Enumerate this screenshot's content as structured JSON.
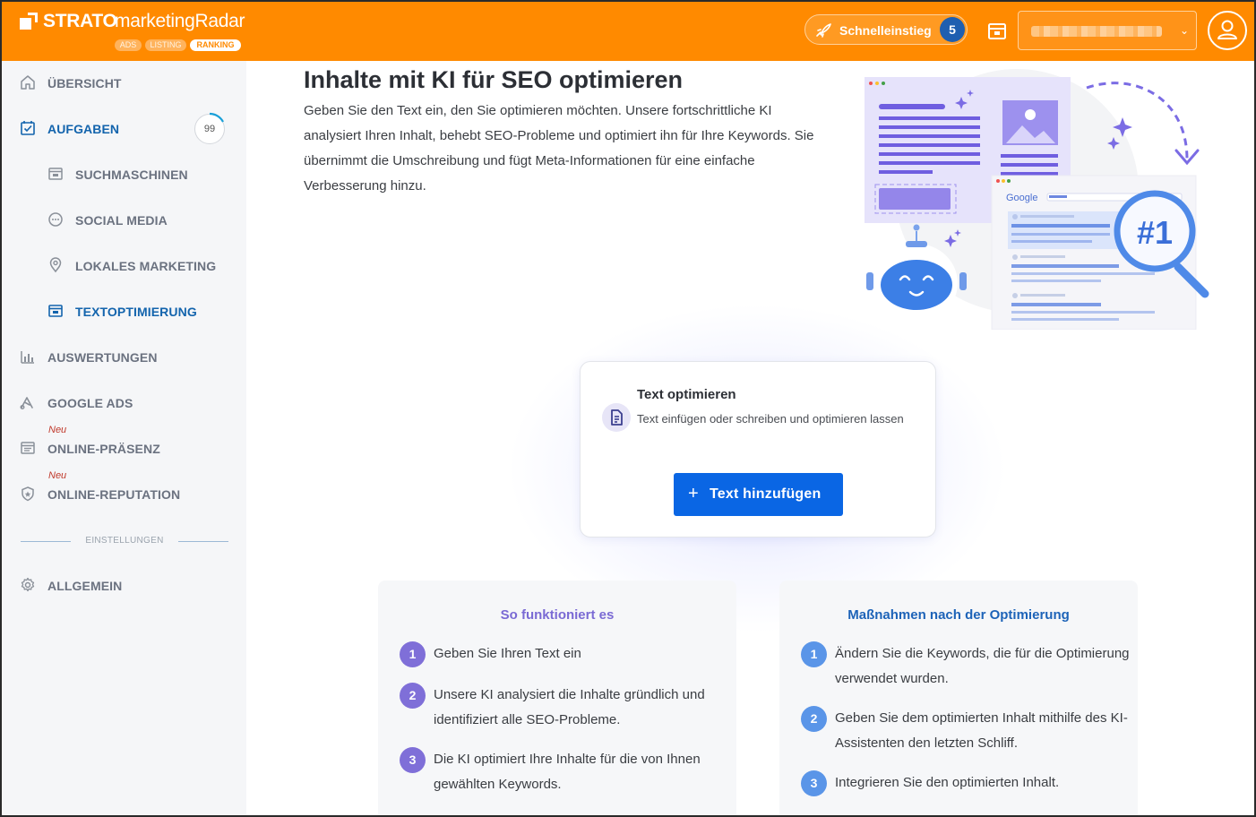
{
  "header": {
    "brand": "STRATO",
    "product": "marketingRadar",
    "pills": [
      "ADS",
      "LISTING",
      "RANKING"
    ],
    "quickstart_label": "Schnelleinstieg",
    "quickstart_count": "5",
    "accent_color": "#ff8a00",
    "badge_color": "#1f5fb0"
  },
  "sidebar": {
    "items": [
      {
        "label": "ÜBERSICHT",
        "icon": "home-icon"
      },
      {
        "label": "AUFGABEN",
        "icon": "checkbox-icon",
        "count": "99"
      },
      {
        "label": "SUCHMASCHINEN",
        "icon": "browser-icon"
      },
      {
        "label": "SOCIAL MEDIA",
        "icon": "chat-bubble-icon"
      },
      {
        "label": "LOKALES MARKETING",
        "icon": "map-pin-icon"
      },
      {
        "label": "TEXTOPTIMIERUNG",
        "icon": "browser-icon"
      },
      {
        "label": "AUSWERTUNGEN",
        "icon": "bar-chart-icon"
      },
      {
        "label": "GOOGLE ADS",
        "icon": "google-ads-icon"
      },
      {
        "label": "ONLINE-PRÄSENZ",
        "icon": "presence-icon",
        "tag": "Neu"
      },
      {
        "label": "ONLINE-REPUTATION",
        "icon": "shield-star-icon",
        "tag": "Neu"
      },
      {
        "label": "ALLGEMEIN",
        "icon": "gear-icon"
      }
    ],
    "settings_separator": "EINSTELLUNGEN"
  },
  "main": {
    "title": "Inhalte mit KI für SEO optimieren",
    "intro": "Geben Sie den Text ein, den Sie optimieren möchten. Unsere fortschrittliche KI analysiert Ihren Inhalt, behebt SEO-Probleme und optimiert ihn für Ihre Keywords. Sie übernimmt die Umschreibung und fügt Meta-Informationen für eine einfache Verbesserung hinzu.",
    "hero": {
      "google_word": "Google",
      "rank_badge": "#1"
    },
    "card": {
      "title": "Text optimieren",
      "description": "Text einfügen oder schreiben und optimieren lassen",
      "button_label": "Text hinzufügen",
      "button_color": "#0a66e4"
    },
    "how_it_works": {
      "title": "So funktioniert es",
      "steps": [
        {
          "num": "1",
          "text": "Geben Sie Ihren Text ein"
        },
        {
          "num": "2",
          "text": "Unsere KI analysiert die Inhalte gründlich und identifiziert alle SEO-Probleme."
        },
        {
          "num": "3",
          "text": "Die KI optimiert Ihre Inhalte für die von Ihnen gewählten Keywords."
        }
      ]
    },
    "after_optimization": {
      "title": "Maßnahmen nach der Optimierung",
      "steps": [
        {
          "num": "1",
          "text": "Ändern Sie die Keywords, die für die Optimierung verwendet wurden."
        },
        {
          "num": "2",
          "text": "Geben Sie dem optimierten Inhalt mithilfe des KI-Assistenten den letzten Schliff."
        },
        {
          "num": "3",
          "text": "Integrieren Sie den optimierten Inhalt."
        }
      ]
    }
  }
}
